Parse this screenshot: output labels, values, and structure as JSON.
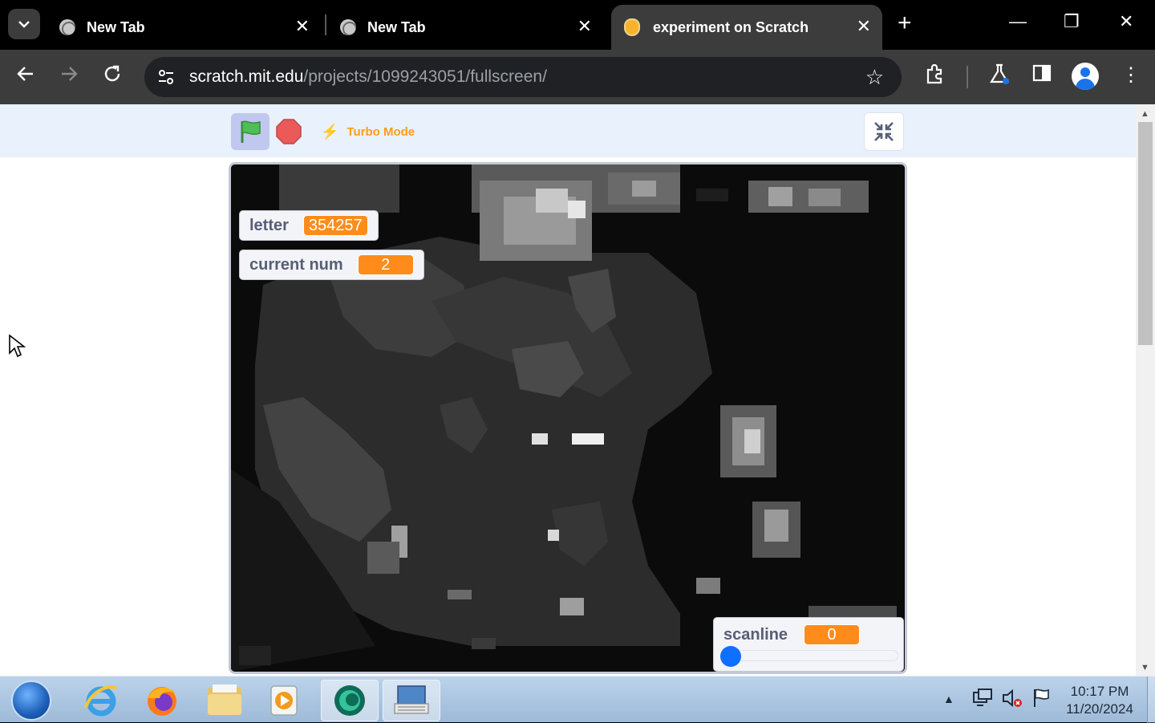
{
  "browser": {
    "tabs": [
      {
        "title": "New Tab",
        "favicon": "globe-icon",
        "active": false
      },
      {
        "title": "New Tab",
        "favicon": "globe-icon",
        "active": false
      },
      {
        "title": "experiment on Scratch",
        "favicon": "scratch-cat-icon",
        "active": true
      }
    ],
    "url": {
      "host": "scratch.mit.edu",
      "path": "/projects/1099243051/fullscreen/"
    }
  },
  "scratch": {
    "turbo_label": "Turbo Mode",
    "monitors": {
      "letter": {
        "label": "letter",
        "value": "354257"
      },
      "current_num": {
        "label": "current num",
        "value": "2"
      },
      "scanline": {
        "label": "scanline",
        "value": "0",
        "slider_fraction": 0
      }
    },
    "colors": {
      "monitor_value": "#ff8c1a",
      "turbo": "#ff9c1a",
      "slider_knob": "#0f6fff",
      "flag_green": "#4cbf56",
      "stop_red": "#ec5959"
    }
  },
  "taskbar": {
    "apps": [
      "windows-start-icon",
      "internet-explorer-icon",
      "firefox-icon",
      "file-explorer-icon",
      "media-player-icon",
      "browser-app-icon",
      "keyboard-app-icon"
    ],
    "clock": {
      "time": "10:17 PM",
      "date": "11/20/2024"
    }
  }
}
